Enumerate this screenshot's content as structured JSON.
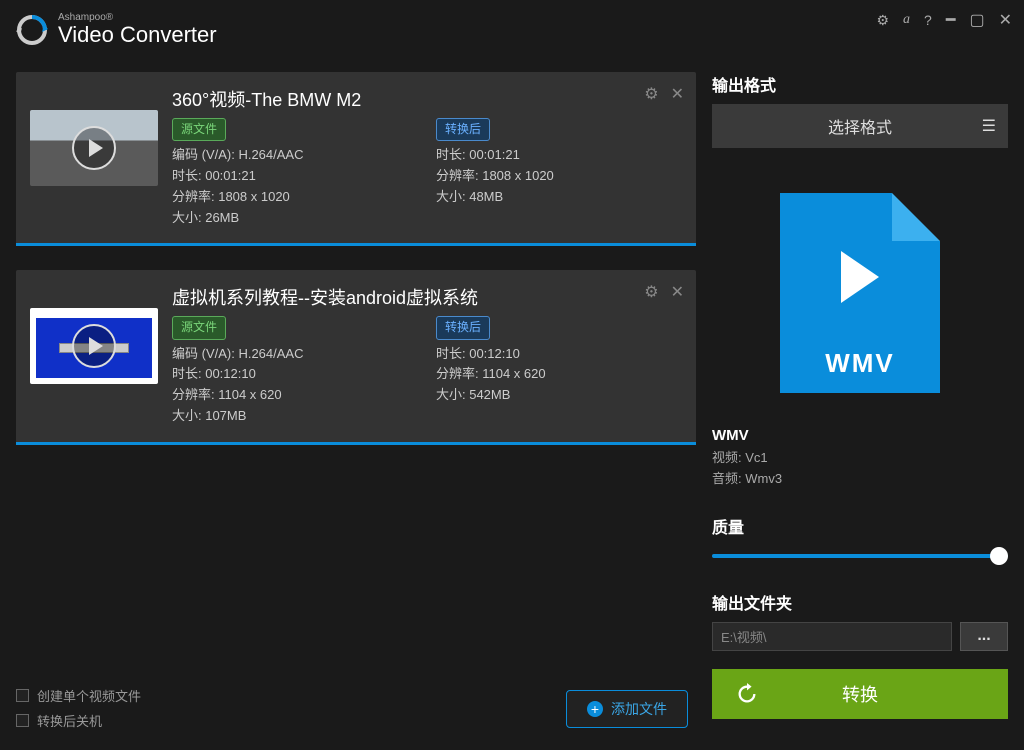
{
  "app": {
    "brand_sup": "Ashampoo®",
    "brand_main": "Video Converter"
  },
  "files": [
    {
      "title": "360°视频-The BMW M2",
      "source_badge": "源文件",
      "source": {
        "codec_label": "编码 (V/A): H.264/AAC",
        "duration": "时长: 00:01:21",
        "resolution": "分辨率: 1808 x 1020",
        "size": "大小: 26MB"
      },
      "target_badge": "转换后",
      "target": {
        "duration": "时长: 00:01:21",
        "resolution": "分辨率: 1808 x 1020",
        "size": "大小: 48MB"
      }
    },
    {
      "title": "虚拟机系列教程--安装android虚拟系统",
      "source_badge": "源文件",
      "source": {
        "codec_label": "编码 (V/A): H.264/AAC",
        "duration": "时长: 00:12:10",
        "resolution": "分辨率: 1104 x 620",
        "size": "大小: 107MB"
      },
      "target_badge": "转换后",
      "target": {
        "duration": "时长: 00:12:10",
        "resolution": "分辨率: 1104 x 620",
        "size": "大小: 542MB"
      }
    }
  ],
  "add_files_label": "添加文件",
  "opts": {
    "merge": "创建单个视频文件",
    "shutdown": "转换后关机"
  },
  "right": {
    "output_format_title": "输出格式",
    "select_format_label": "选择格式",
    "format_ext": "WMV",
    "format_name": "WMV",
    "video_codec": "视频: Vc1",
    "audio_codec": "音频: Wmv3",
    "quality_title": "质量",
    "outdir_title": "输出文件夹",
    "outdir_path": "E:\\视频\\",
    "browse_label": "...",
    "convert_label": "转换"
  }
}
